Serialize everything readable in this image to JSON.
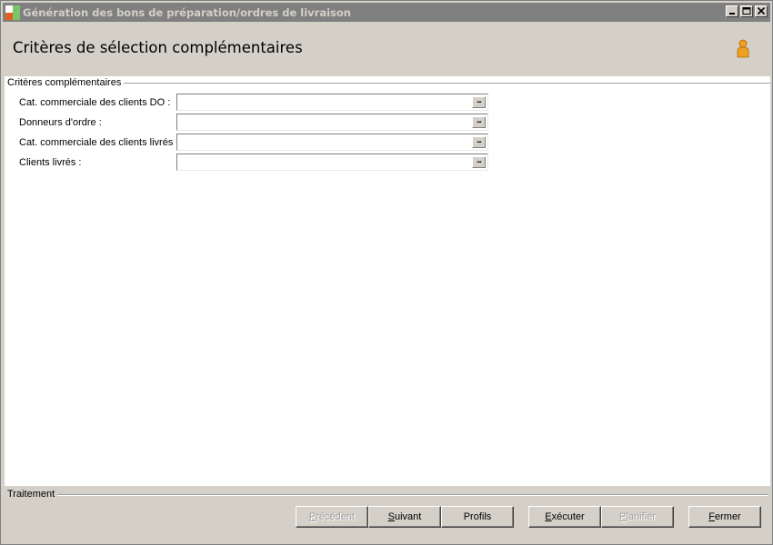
{
  "window": {
    "title": "Génération des bons de préparation/ordres de livraison",
    "controls": [
      "minimize-icon",
      "maximize-icon",
      "close-icon"
    ]
  },
  "header": {
    "title": "Critères de sélection complémentaires",
    "icon": "user-icon"
  },
  "criteria": {
    "group_label": "Critères complémentaires",
    "fields": [
      {
        "label": "Cat. commerciale des clients DO :",
        "value": "",
        "button": "..."
      },
      {
        "label": "Donneurs d'ordre :",
        "value": "",
        "button": "..."
      },
      {
        "label": "Cat. commerciale des clients livrés :",
        "value": "",
        "button": "..."
      },
      {
        "label": "Clients livrés :",
        "value": "",
        "button": "..."
      }
    ]
  },
  "footer": {
    "group_label": "Traitement",
    "buttons": [
      {
        "first": "P",
        "rest": "récédent",
        "enabled": false
      },
      {
        "first": "S",
        "rest": "uivant",
        "enabled": true
      },
      {
        "first": "Profils",
        "rest": "",
        "enabled": true
      },
      {
        "first": "E",
        "rest": "xécuter",
        "enabled": true
      },
      {
        "first": "P",
        "rest": "lanifier",
        "enabled": false
      },
      {
        "first": "F",
        "rest": "ermer",
        "enabled": true
      }
    ]
  },
  "colors": {
    "titlebar": "#808080",
    "title_text": "#d4d0c8",
    "chrome": "#d4d0c8",
    "content_bg": "#ffffff",
    "user_icon": "#f0a020"
  }
}
